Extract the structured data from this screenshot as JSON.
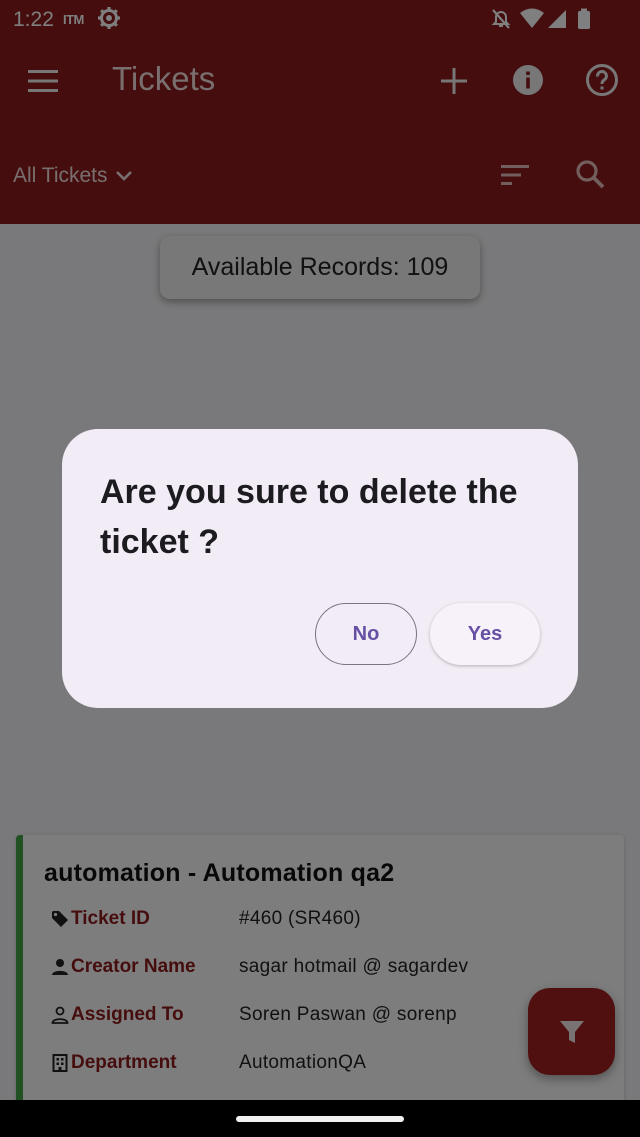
{
  "status_bar": {
    "time": "1:22",
    "carrier": "ITM",
    "icons": [
      "gear-icon",
      "mute-icon",
      "wifi-icon",
      "signal-icon",
      "battery-icon"
    ]
  },
  "app_bar": {
    "title": "Tickets",
    "filter_label": "All Tickets",
    "icons": [
      "menu-icon",
      "add-icon",
      "info-icon",
      "help-icon",
      "sort-icon",
      "search-icon"
    ]
  },
  "records_label": "Available Records: 109",
  "ticket_card": {
    "title": "automation - Automation qa2",
    "rows": [
      {
        "label": "Ticket ID",
        "value": "#460  (SR460)",
        "icon": "tag-icon"
      },
      {
        "label": "Creator Name",
        "value": "sagar hotmail @ sagardev",
        "icon": "person-icon"
      },
      {
        "label": "Assigned To",
        "value": "Soren Paswan @ sorenp",
        "icon": "person-outline-icon"
      },
      {
        "label": "Department",
        "value": "AutomationQA",
        "icon": "building-icon"
      }
    ]
  },
  "dialog": {
    "title": "Are you sure to delete the ticket ?",
    "no_label": "No",
    "yes_label": "Yes"
  },
  "colors": {
    "brand": "#8b1a1a",
    "card_accent": "#43a047",
    "dialog_bg": "#f1ecf5",
    "dialog_button_text": "#6750a4"
  }
}
